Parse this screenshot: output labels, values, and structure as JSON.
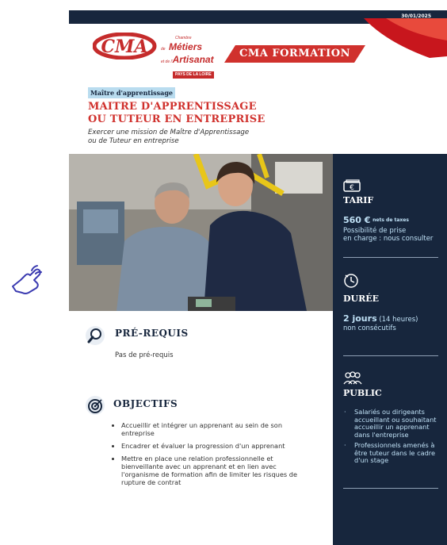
{
  "header": {
    "date": "30/01/2025",
    "logo_mark": "CMA",
    "logo_line1": "Chambre",
    "logo_line2_prefix": "de",
    "logo_line2": "Métiers",
    "logo_line3_prefix": "et de l'",
    "logo_line3": "Artisanat",
    "logo_region": "PAYS DE LA LOIRE",
    "banner": "CMA FORMATION",
    "colors": {
      "navy": "#17263d",
      "red": "#d0312d",
      "tag_blue": "#b9dcef"
    }
  },
  "course": {
    "tag": "Maître d'apprentissage",
    "title_line1": "MAITRE D'APPRENTISSAGE",
    "title_line2": "OU TUTEUR EN ENTREPRISE",
    "subtitle_line1": "Exercer une mission de Maître d'Apprentissage",
    "subtitle_line2": "ou de Tuteur en entreprise"
  },
  "sections": {
    "prerequis": {
      "icon": "magnifier-icon",
      "heading": "PRÉ-REQUIS",
      "text": "Pas de pré-requis"
    },
    "objectifs": {
      "icon": "target-icon",
      "heading": "OBJECTIFS",
      "items": [
        "Accueillir et intégrer un apprenant au sein de son entreprise",
        "Encadrer et évaluer la progression d'un apprenant",
        "Mettre en place une relation professionnelle et bienveillante avec un apprenant et en lien avec l'organisme de formation afin de limiter les risques de rupture de contrat"
      ]
    }
  },
  "sidebar": {
    "tarif": {
      "icon": "euro-bill-icon",
      "heading": "TARIF",
      "price": "560 €",
      "price_note": "nets de taxes",
      "line1": "Possibilité de prise",
      "line2": "en charge : nous consulter"
    },
    "duree": {
      "icon": "clock-icon",
      "heading": "DURÉE",
      "value": "2 jours",
      "value_note": "(14 heures)",
      "line1": "non consécutifs"
    },
    "public": {
      "icon": "people-icon",
      "heading": "PUBLIC",
      "items": [
        "Salariés ou dirigeants accueillant ou souhaitant accueillir un apprenant dans l'entreprise",
        "Professionnels amenés à être tuteur dans le cadre d'un stage"
      ]
    }
  },
  "overlay": {
    "icon": "pointer-hand-icon"
  }
}
